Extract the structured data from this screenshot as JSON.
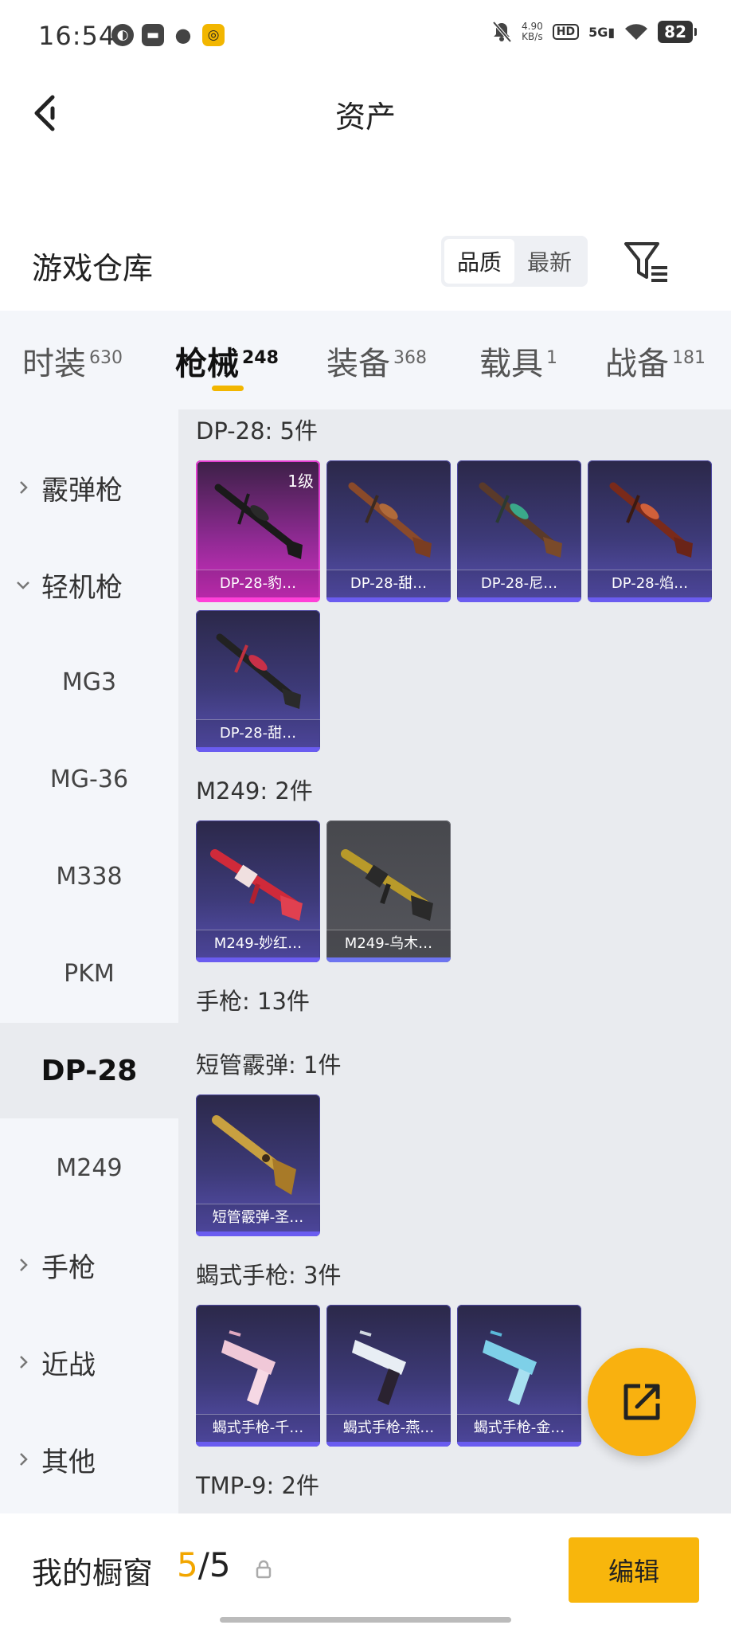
{
  "status_bar": {
    "time": "16:54",
    "net_rate_value": "4.90",
    "net_rate_unit": "KB/s",
    "hd": "HD",
    "network": "5G",
    "battery": "82"
  },
  "header": {
    "title": "资产"
  },
  "warehouse": {
    "title": "游戏仓库",
    "sort_options": [
      "品质",
      "最新"
    ],
    "active_sort": "品质"
  },
  "tabs": [
    {
      "label": "时装",
      "count": "630"
    },
    {
      "label": "枪械",
      "count": "248"
    },
    {
      "label": "装备",
      "count": "368"
    },
    {
      "label": "载具",
      "count": "1"
    },
    {
      "label": "战备",
      "count": "181"
    }
  ],
  "active_tab": "枪械",
  "sidebar": {
    "items": [
      {
        "label": "霰弹枪",
        "type": "group",
        "expanded": false
      },
      {
        "label": "轻机枪",
        "type": "group",
        "expanded": true
      },
      {
        "label": "MG3",
        "type": "sub"
      },
      {
        "label": "MG-36",
        "type": "sub"
      },
      {
        "label": "M338",
        "type": "sub"
      },
      {
        "label": "PKM",
        "type": "sub"
      },
      {
        "label": "DP-28",
        "type": "sub",
        "selected": true
      },
      {
        "label": "M249",
        "type": "sub"
      },
      {
        "label": "手枪",
        "type": "group",
        "expanded": false
      },
      {
        "label": "近战",
        "type": "group",
        "expanded": false
      },
      {
        "label": "其他",
        "type": "group",
        "expanded": false
      }
    ]
  },
  "groups": [
    {
      "label": "DP-28: 5件",
      "items": [
        {
          "name": "DP-28-豹…",
          "level": "1级",
          "rarity": "legendary"
        },
        {
          "name": "DP-28-甜…",
          "rarity": "epic"
        },
        {
          "name": "DP-28-尼…",
          "rarity": "epic"
        },
        {
          "name": "DP-28-焰…",
          "rarity": "epic"
        },
        {
          "name": "DP-28-甜…",
          "rarity": "epic"
        }
      ]
    },
    {
      "label": "M249: 2件",
      "items": [
        {
          "name": "M249-妙红…",
          "rarity": "epic"
        },
        {
          "name": "M249-乌木…",
          "rarity": "rare"
        }
      ]
    },
    {
      "label": "手枪: 13件",
      "items": []
    },
    {
      "label": "短管霰弹: 1件",
      "items": [
        {
          "name": "短管霰弹-圣…",
          "rarity": "epic"
        }
      ]
    },
    {
      "label": "蝎式手枪: 3件",
      "items": [
        {
          "name": "蝎式手枪-千…",
          "rarity": "epic"
        },
        {
          "name": "蝎式手枪-燕…",
          "rarity": "epic"
        },
        {
          "name": "蝎式手枪-金…",
          "rarity": "epic"
        }
      ]
    },
    {
      "label": "TMP-9: 2件",
      "items": []
    }
  ],
  "bottom": {
    "showcase_label": "我的橱窗",
    "showcase_current": "5",
    "showcase_sep": "/",
    "showcase_total": "5",
    "edit_label": "编辑"
  },
  "colors": {
    "accent": "#f8b60c",
    "legendary": "#e23fd0",
    "epic": "#5951b3",
    "rare": "#55565c"
  }
}
